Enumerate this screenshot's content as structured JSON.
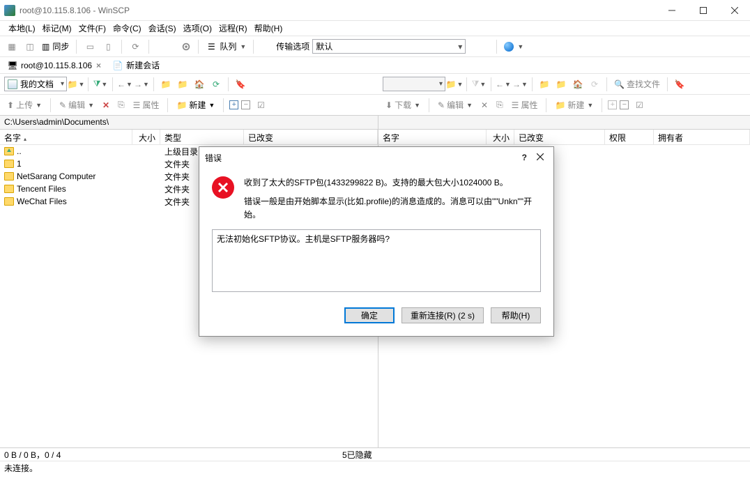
{
  "window": {
    "title": "root@10.115.8.106 - WinSCP"
  },
  "menus": {
    "local": "本地(L)",
    "mark": "标记(M)",
    "files": "文件(F)",
    "commands": "命令(C)",
    "session": "会话(S)",
    "options": "选项(O)",
    "remote": "远程(R)",
    "help": "帮助(H)"
  },
  "toolbar": {
    "sync_label": "同步",
    "queue_label": "队列",
    "transfer_label": "传输选项",
    "transfer_value": "默认"
  },
  "tabs": {
    "session_name": "root@10.115.8.106",
    "new_session": "新建会话"
  },
  "nav": {
    "left_location": "我的文档",
    "find_label": "查找文件"
  },
  "actions": {
    "upload": "上传",
    "download": "下载",
    "edit": "编辑",
    "delete": "",
    "props": "属性",
    "new": "新建"
  },
  "paths": {
    "left": "C:\\Users\\admin\\Documents\\"
  },
  "columns": {
    "name": "名字",
    "size": "大小",
    "type": "类型",
    "modified": "已改变",
    "rights": "权限",
    "owner": "拥有者"
  },
  "files": [
    {
      "name": "..",
      "type": "上级目录",
      "up": true
    },
    {
      "name": "1",
      "type": "文件夹"
    },
    {
      "name": "NetSarang Computer",
      "type": "文件夹"
    },
    {
      "name": "Tencent Files",
      "type": "文件夹"
    },
    {
      "name": "WeChat Files",
      "type": "文件夹"
    }
  ],
  "status": {
    "selection": "0 B / 0 B，0 / 4",
    "hidden": "5已隐藏",
    "connection": "未连接。"
  },
  "dialog": {
    "title": "错误",
    "message_line1": "收到了太大的SFTP包(1433299822 B)。支持的最大包大小1024000 B。",
    "message_line2": "错误一般是由开始脚本显示(比如.profile)的消息造成的。消息可以由\"\"Unkn\"\"开始。",
    "detail": "无法初始化SFTP协议。主机是SFTP服务器吗?",
    "ok": "确定",
    "reconnect": "重新连接(R) (2 s)",
    "help": "帮助(H)"
  }
}
